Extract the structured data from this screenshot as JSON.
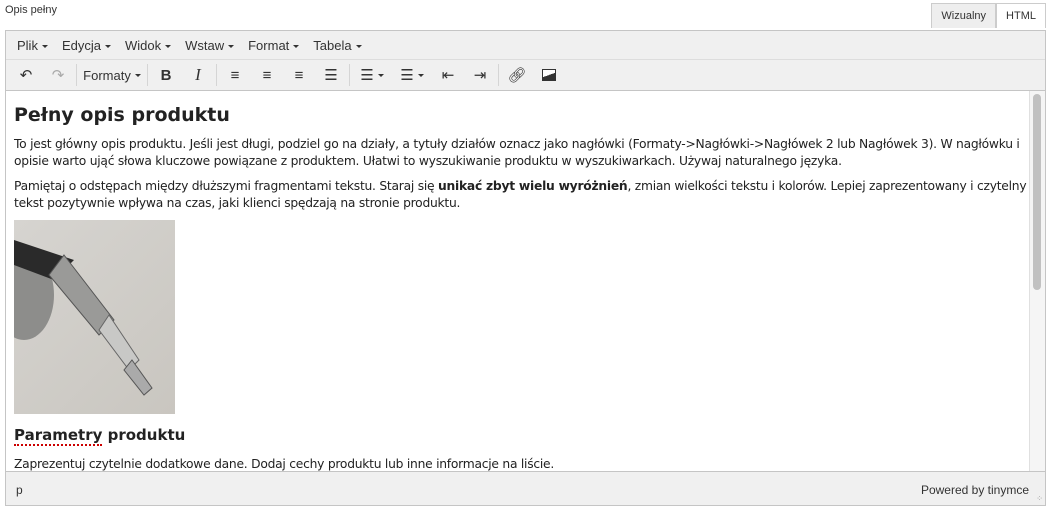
{
  "field_label": "Opis pełny",
  "tabs": [
    {
      "label": "Wizualny",
      "active": true
    },
    {
      "label": "HTML",
      "active": false
    }
  ],
  "menubar": [
    "Plik",
    "Edycja",
    "Widok",
    "Wstaw",
    "Format",
    "Tabela"
  ],
  "toolbar": {
    "formats_label": "Formaty",
    "icons": [
      "undo-icon",
      "redo-icon",
      "bold-icon",
      "italic-icon",
      "align-left-icon",
      "align-center-icon",
      "align-right-icon",
      "align-justify-icon",
      "bullet-list-icon",
      "numbered-list-icon",
      "outdent-icon",
      "indent-icon",
      "link-icon",
      "image-icon"
    ]
  },
  "content": {
    "heading": "Pełny opis produktu",
    "p1": "To jest główny opis produktu. Jeśli jest długi, podziel go na działy, a tytuły działów oznacz jako nagłówki (Formaty->Nagłówki->Nagłówek 2 lub Nagłówek 3). W nagłówku i opisie warto ująć słowa kluczowe powiązane z produktem. Ułatwi to wyszukiwanie produktu w wyszukiwarkach. Używaj naturalnego języka.",
    "p2_before": "Pamiętaj o odstępach między dłuższymi fragmentami tekstu. Staraj się ",
    "p2_bold": "unikać zbyt wielu wyróżnień",
    "p2_after": ", zmian wielkości tekstu i kolorów. Lepiej zaprezentowany i czytelny tekst pozytywnie wpływa na czas, jaki klienci spędzają na stronie produktu.",
    "subheading_word1": "Parametry",
    "subheading_word2": " produktu",
    "p3": "Zaprezentuj czytelnie dodatkowe dane. Dodaj cechy produktu lub inne informacje na liście."
  },
  "status": {
    "path": "p",
    "powered": "Powered by tinymce"
  }
}
